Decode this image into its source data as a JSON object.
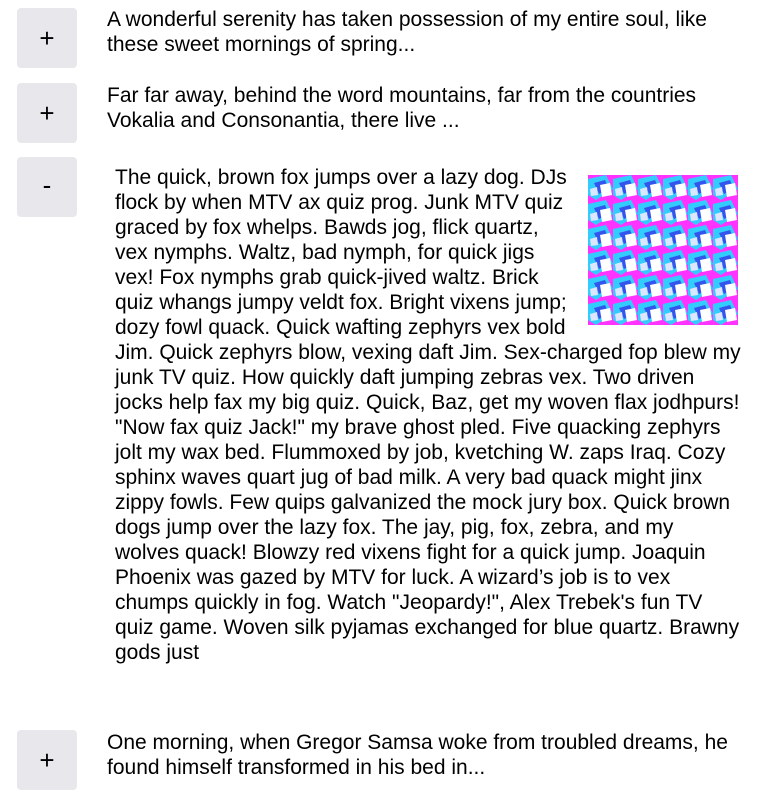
{
  "items": [
    {
      "toggle": "+",
      "text": "A wonderful serenity has taken possession of my entire soul, like these sweet mornings of spring..."
    },
    {
      "toggle": "+",
      "text": "Far far away, behind the word mountains, far from the countries Vokalia and Consonantia, there live ..."
    },
    {
      "toggle": "-",
      "text": "The quick, brown fox jumps over a lazy dog. DJs flock by when MTV ax quiz prog. Junk MTV quiz graced by fox whelps. Bawds jog, flick quartz, vex nymphs. Waltz, bad nymph, for quick jigs vex! Fox nymphs grab quick-jived waltz. Brick quiz whangs jumpy veldt fox. Bright vixens jump; dozy fowl quack. Quick wafting zephyrs vex bold Jim. Quick zephyrs blow, vexing daft Jim. Sex-charged fop blew my junk TV quiz. How quickly daft jumping zebras vex. Two driven jocks help fax my big quiz. Quick, Baz, get my woven flax jodhpurs! \"Now fax quiz Jack!\" my brave ghost pled. Five quacking zephyrs jolt my wax bed. Flummoxed by job, kvetching W. zaps Iraq. Cozy sphinx waves quart jug of bad milk. A very bad quack might jinx zippy fowls. Few quips galvanized the mock jury box. Quick brown dogs jump over the lazy fox. The jay, pig, fox, zebra, and my wolves quack! Blowzy red vixens fight for a quick jump. Joaquin Phoenix was gazed by MTV for luck. A wizard’s job is to vex chumps quickly in fog. Watch \"Jeopardy!\", Alex Trebek's fun TV quiz game. Woven silk pyjamas exchanged for blue quartz. Brawny gods just"
    },
    {
      "toggle": "+",
      "text": "One morning, when Gregor Samsa woke from troubled dreams, he found himself transformed in his bed in..."
    }
  ],
  "image": {
    "icon": "pattern-thumbnail",
    "colors": [
      "#ff33ff",
      "#33ccff",
      "#3355ee",
      "#ffffff"
    ]
  }
}
